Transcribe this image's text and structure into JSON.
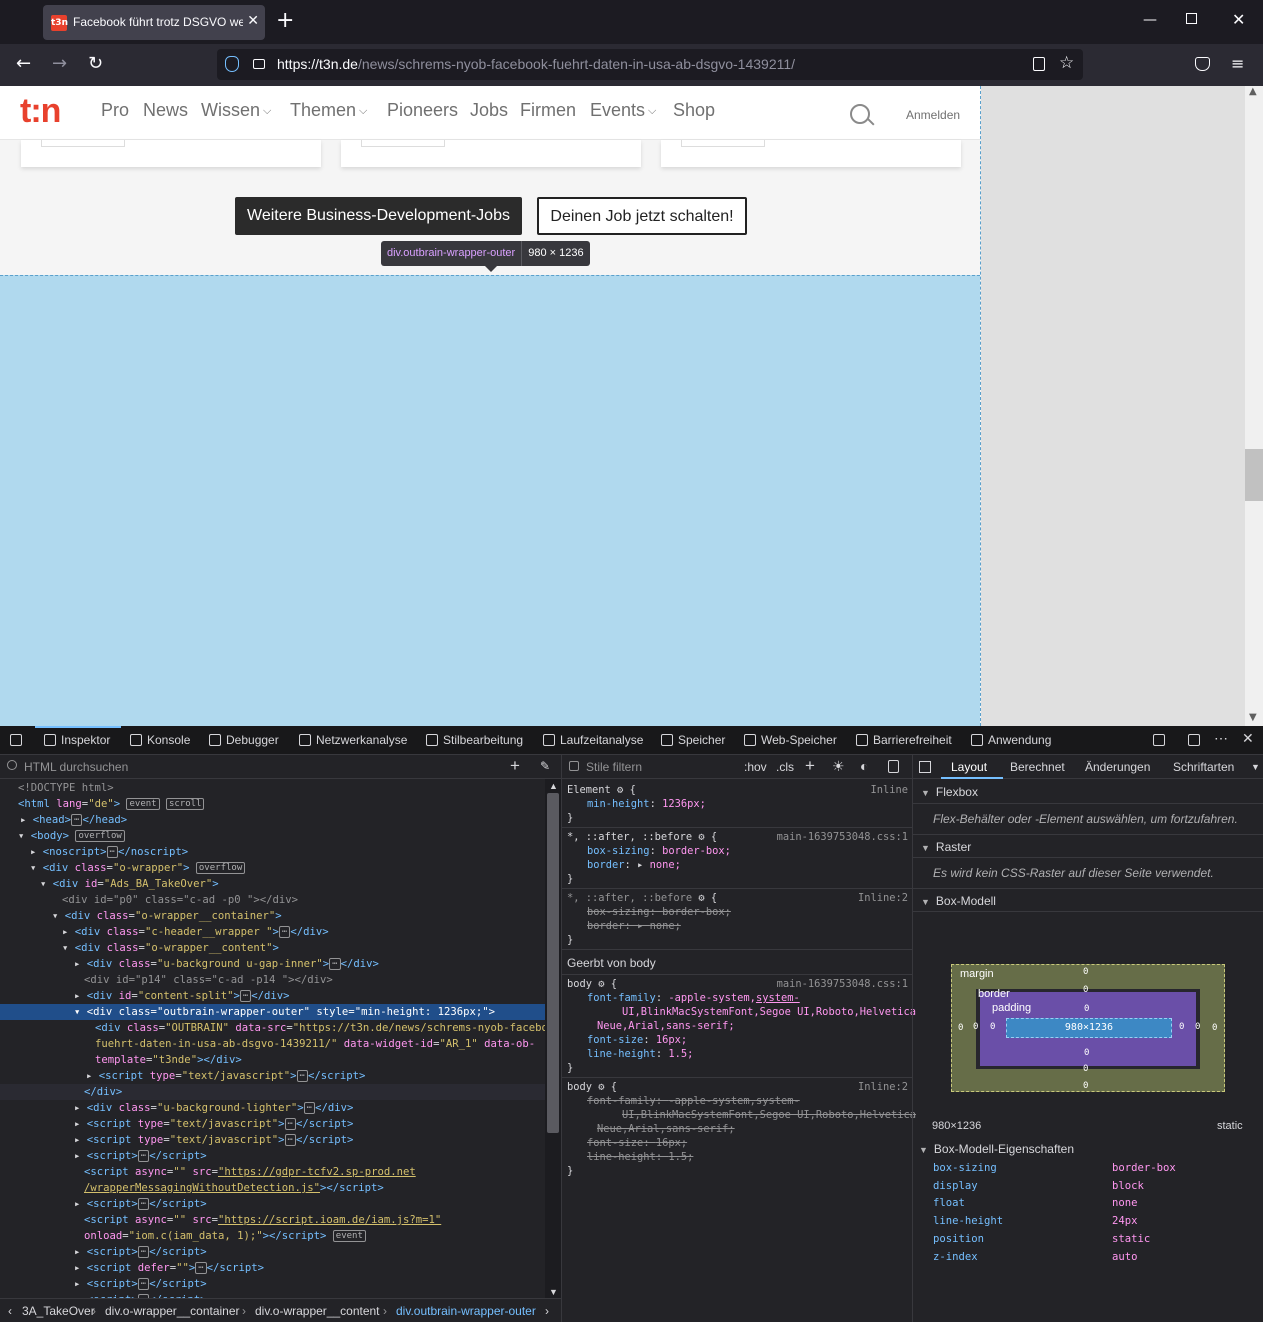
{
  "browser": {
    "tab_title": "Facebook führt trotz DSGVO we",
    "tab_favicon": "t3n",
    "url_host": "https://t3n.de",
    "url_path": "/news/schrems-nyob-facebook-fuehrt-daten-in-usa-ab-dsgvo-1439211/"
  },
  "site": {
    "logo": "t:n",
    "menu": [
      "Pro",
      "News",
      "Wissen",
      "Themen",
      "Pioneers",
      "Jobs",
      "Firmen",
      "Events",
      "Shop"
    ],
    "login": "Anmelden",
    "btn_more": "Weitere Business-Development-Jobs",
    "btn_post": "Deinen Job jetzt schalten!",
    "tooltip_selector": "div.outbrain-wrapper-outer",
    "tooltip_size": "980 × 1236",
    "accent": "#e8412d"
  },
  "devtools": {
    "tabs": [
      "Inspektor",
      "Konsole",
      "Debugger",
      "Netzwerkanalyse",
      "Stilbearbeitung",
      "Laufzeitanalyse",
      "Speicher",
      "Web-Speicher",
      "Barrierefreiheit",
      "Anwendung"
    ],
    "html_search_placeholder": "HTML durchsuchen",
    "styles_filter_placeholder": "Stile filtern",
    "hov": ":hov",
    "cls": ".cls",
    "breadcrumbs": [
      "3A_TakeOver",
      "div.o-wrapper__container",
      "div.o-wrapper__content",
      "div.outbrain-wrapper-outer"
    ],
    "layout_tabs": [
      "Layout",
      "Berechnet",
      "Änderungen",
      "Schriftarten"
    ],
    "flexbox_title": "Flexbox",
    "flexbox_note": "Flex-Behälter oder -Element auswählen, um fortzufahren.",
    "grid_title": "Raster",
    "grid_note": "Es wird kein CSS-Raster auf dieser Seite verwendet.",
    "boxmodel_title": "Box-Modell",
    "boxmodel": {
      "margin": "margin",
      "border": "border",
      "padding": "padding",
      "content": "980×1236",
      "zero": "0"
    },
    "dimensions": "980×1236",
    "position_value": "static",
    "props_title": "Box-Modell-Eigenschaften",
    "props": [
      {
        "k": "box-sizing",
        "v": "border-box"
      },
      {
        "k": "display",
        "v": "block"
      },
      {
        "k": "float",
        "v": "none"
      },
      {
        "k": "line-height",
        "v": "24px"
      },
      {
        "k": "position",
        "v": "static"
      },
      {
        "k": "z-index",
        "v": "auto"
      }
    ],
    "rules": {
      "element": "Element",
      "inline": "Inline",
      "min_height_prop": "min-height",
      "min_height_val": "1236px;",
      "star_sel": "*, ::after, ::before",
      "src1": "main-1639753048.css:1",
      "src_inline2": "Inline:2",
      "box_sizing": "box-sizing",
      "border_box": "border-box;",
      "border": "border",
      "none": "none;",
      "inherited": "Geerbt von body",
      "body": "body",
      "font_family": "font-family",
      "ff_val1": "-apple-system,",
      "ff_val2": "system-",
      "ff_val3": "UI,BlinkMacSystemFont,Segoe UI,Roboto,Helvetica",
      "ff_val4": "Neue,Arial,sans-serif;",
      "font_size": "font-size",
      "fs_val": "16px;",
      "line_height": "line-height",
      "lh_val": "1.5;"
    }
  }
}
